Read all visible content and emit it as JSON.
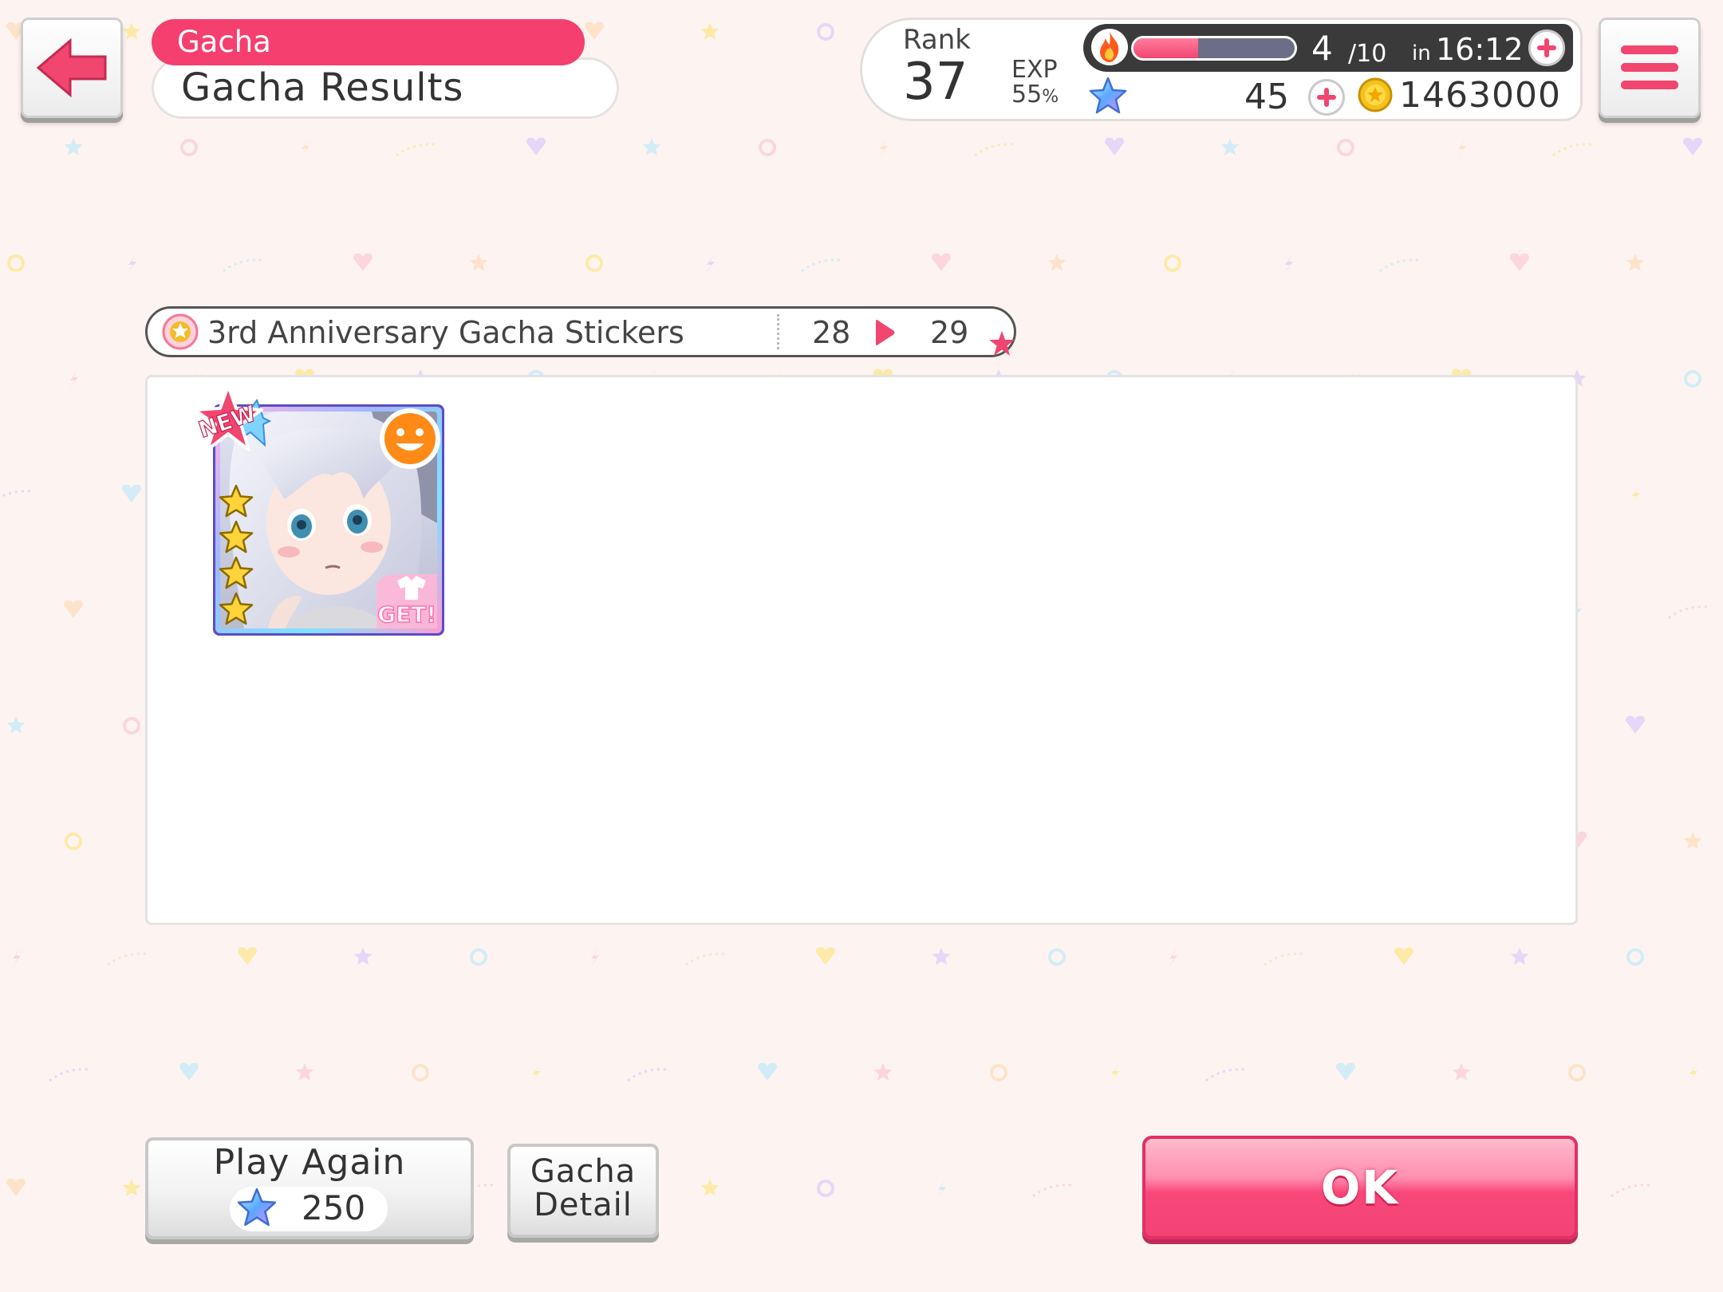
{
  "header": {
    "breadcrumb": "Gacha",
    "title": "Gacha Results"
  },
  "player": {
    "rank_label": "Rank",
    "rank": "37",
    "exp_label": "EXP",
    "exp_percent": "55",
    "exp_unit": "%",
    "stamina_current": "4",
    "stamina_max": "/10",
    "stamina_recover_prefix": "in",
    "stamina_recover_time": "16:12",
    "stamina_fill_fraction": 0.4,
    "stars": "45",
    "coins": "1463000"
  },
  "stickers": {
    "title": "3rd Anniversary Gacha Stickers",
    "from": "28",
    "to": "29"
  },
  "results": {
    "cards": [
      {
        "rarity_stars": 4,
        "is_new": true,
        "new_label": "NEW",
        "costume_label": "GET!",
        "attribute_icon": "happy-face-icon"
      }
    ]
  },
  "actions": {
    "play_again_label": "Play Again",
    "play_again_cost": "250",
    "gacha_detail_line1": "Gacha",
    "gacha_detail_line2": "Detail",
    "ok_label": "OK"
  },
  "colors": {
    "accent_pink": "#f43f6f",
    "background": "#fdf4f2",
    "stamina_bar_dark": "#3a3a3a"
  }
}
